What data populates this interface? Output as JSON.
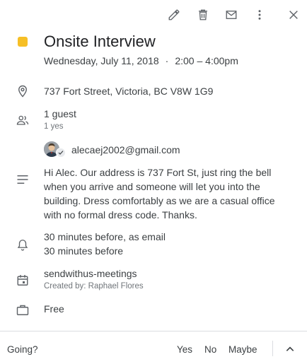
{
  "toolbar": {
    "icons": [
      "edit-icon",
      "delete-icon",
      "email-icon",
      "more-vert-icon",
      "close-icon"
    ]
  },
  "event": {
    "color": "#f6bf26",
    "title": "Onsite Interview",
    "date": "Wednesday, July 11, 2018",
    "separator": "·",
    "time": "2:00 – 4:00pm",
    "location": "737 Fort Street, Victoria, BC V8W 1G9",
    "guests": {
      "count_label": "1 guest",
      "summary": "1 yes",
      "list": [
        {
          "email": "alecaej2002@gmail.com",
          "status": "yes"
        }
      ]
    },
    "description": "Hi Alec. Our address is 737 Fort St, just ring the bell when you arrive and someone will let you into the building. Dress comfortably as we are a casual office with no formal dress code. Thanks.",
    "reminders": [
      "30 minutes before, as email",
      "30 minutes before"
    ],
    "calendar": {
      "name": "sendwithus-meetings",
      "created_by": "Created by: Raphael Flores"
    },
    "availability": "Free"
  },
  "footer": {
    "going_label": "Going?",
    "yes": "Yes",
    "no": "No",
    "maybe": "Maybe"
  }
}
